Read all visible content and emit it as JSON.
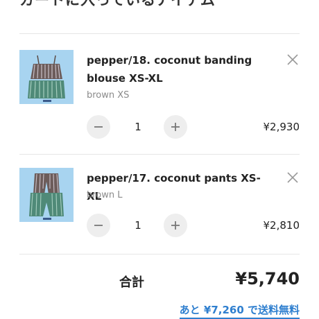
{
  "cart": {
    "title": "カートに入っているアイテム"
  },
  "items": [
    {
      "name": "pepper/18. coconut banding blouse XS-XL",
      "variant": "brown XS",
      "quantity": "1",
      "price": "¥2,930",
      "minus_label": "−",
      "plus_label": "+",
      "thumbnail_icon": "blouse-product-photo"
    },
    {
      "name": "pepper/17. coconut pants XS-XL",
      "variant": "brown L",
      "quantity": "1",
      "price": "¥2,810",
      "minus_label": "−",
      "plus_label": "+",
      "thumbnail_icon": "pants-product-photo"
    }
  ],
  "summary": {
    "total_label": "合計",
    "total_value": "¥5,740",
    "shipping_note": "あと ¥7,260 で送料無料"
  },
  "colors": {
    "link": "#2f7fcf",
    "thumb_bg": "#a8d4f0",
    "stepper_bg": "#eeeeee"
  }
}
